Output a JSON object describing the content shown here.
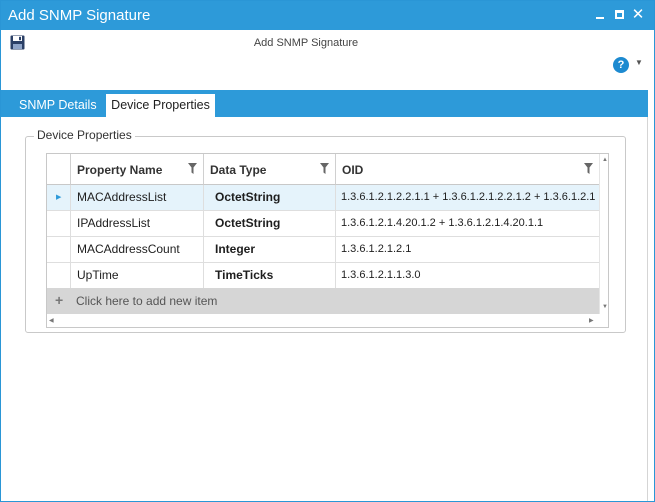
{
  "window": {
    "title": "Add SNMP Signature",
    "minimize_icon": "minimize-icon",
    "maximize_icon": "maximize-icon",
    "close_icon": "close-icon",
    "accent_color": "#2d9ad9"
  },
  "toolbar": {
    "save_icon": "save-icon",
    "caption": "Add SNMP Signature",
    "help_icon": "help-icon",
    "help_glyph": "?",
    "help_dropdown_icon": "chevron-down-icon"
  },
  "tabs": [
    {
      "label": "SNMP Details",
      "active": false
    },
    {
      "label": "Device Properties",
      "active": true
    }
  ],
  "group": {
    "legend": "Device Properties"
  },
  "grid": {
    "columns": [
      "Property Name",
      "Data Type",
      "OID"
    ],
    "filter_icon": "filter-icon",
    "rows": [
      {
        "name": "MACAddressList",
        "type": "OctetString",
        "oid": "1.3.6.1.2.1.2.2.1.1 + 1.3.6.1.2.1.2.2.1.2 + 1.3.6.1.2.1",
        "selected": true
      },
      {
        "name": "IPAddressList",
        "type": "OctetString",
        "oid": "1.3.6.1.2.1.4.20.1.2 + 1.3.6.1.2.1.4.20.1.1",
        "selected": false
      },
      {
        "name": "MACAddressCount",
        "type": "Integer",
        "oid": "1.3.6.1.2.1.2.1",
        "selected": false
      },
      {
        "name": "UpTime",
        "type": "TimeTicks",
        "oid": "1.3.6.1.2.1.1.3.0",
        "selected": false
      }
    ],
    "add_row_label": "Click here to add new item"
  }
}
